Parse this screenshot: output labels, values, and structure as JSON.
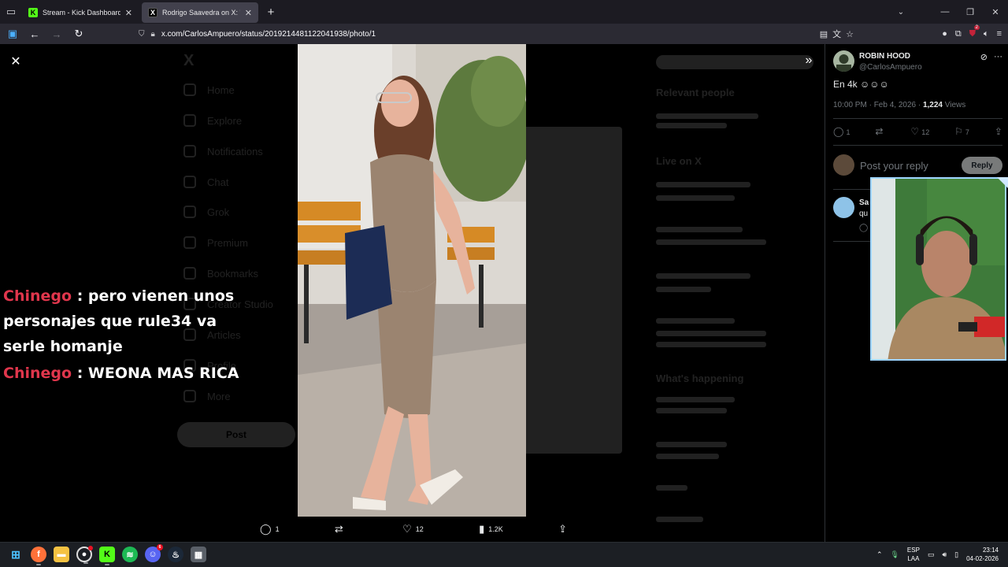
{
  "browser": {
    "tabs": [
      {
        "title": "Stream - Kick Dashboard",
        "active": false,
        "icon": "kick-icon"
      },
      {
        "title": "Rodrigo Saavedra on X: \"Perm",
        "active": true,
        "icon": "x-icon"
      }
    ],
    "url": "x.com/CarlosAmpuero/status/2019214481122041938/photo/1",
    "extension_badge": "2"
  },
  "media": {
    "actions": {
      "replies": "1",
      "reposts": "",
      "likes": "12",
      "views": "1.2K"
    }
  },
  "chat": {
    "messages": [
      {
        "user": "Chinego",
        "text": ": pero vienen unos personajes que rule34 va serle homanje"
      },
      {
        "user": "Chinego",
        "text": ": WEONA MAS RICA"
      }
    ]
  },
  "background_blur": {
    "nav": [
      "Home",
      "Explore",
      "Notifications",
      "Chat",
      "Grok",
      "Premium",
      "Bookmarks",
      "Creator Studio",
      "Articles",
      "Profile",
      "More"
    ],
    "post_button": "Post",
    "right_headings": [
      "Relevant people",
      "Live on X",
      "What's happening"
    ]
  },
  "panel": {
    "author_name": "ROBIN HOOD",
    "author_handle": "@CarlosAmpuero",
    "tweet_text": "En 4k ☺☺☺",
    "time": "10:00 PM · Feb 4, 2026 · ",
    "views_count": "1,224",
    "views_label": " Views",
    "actions": {
      "replies": "1",
      "reposts": "",
      "likes": "12",
      "bookmarks": "7"
    },
    "reply_placeholder": "Post your reply",
    "reply_button": "Reply",
    "comment": {
      "name": "Sa",
      "text": "qu"
    }
  },
  "taskbar": {
    "lang_top": "ESP",
    "lang_bottom": "LAA",
    "time": "23:14",
    "date": "04-02-2026",
    "discord_badge": "6"
  },
  "colors": {
    "chat_user": "#e0364c",
    "kick_green": "#53fc18",
    "x_accent": "#1d9bf0"
  }
}
